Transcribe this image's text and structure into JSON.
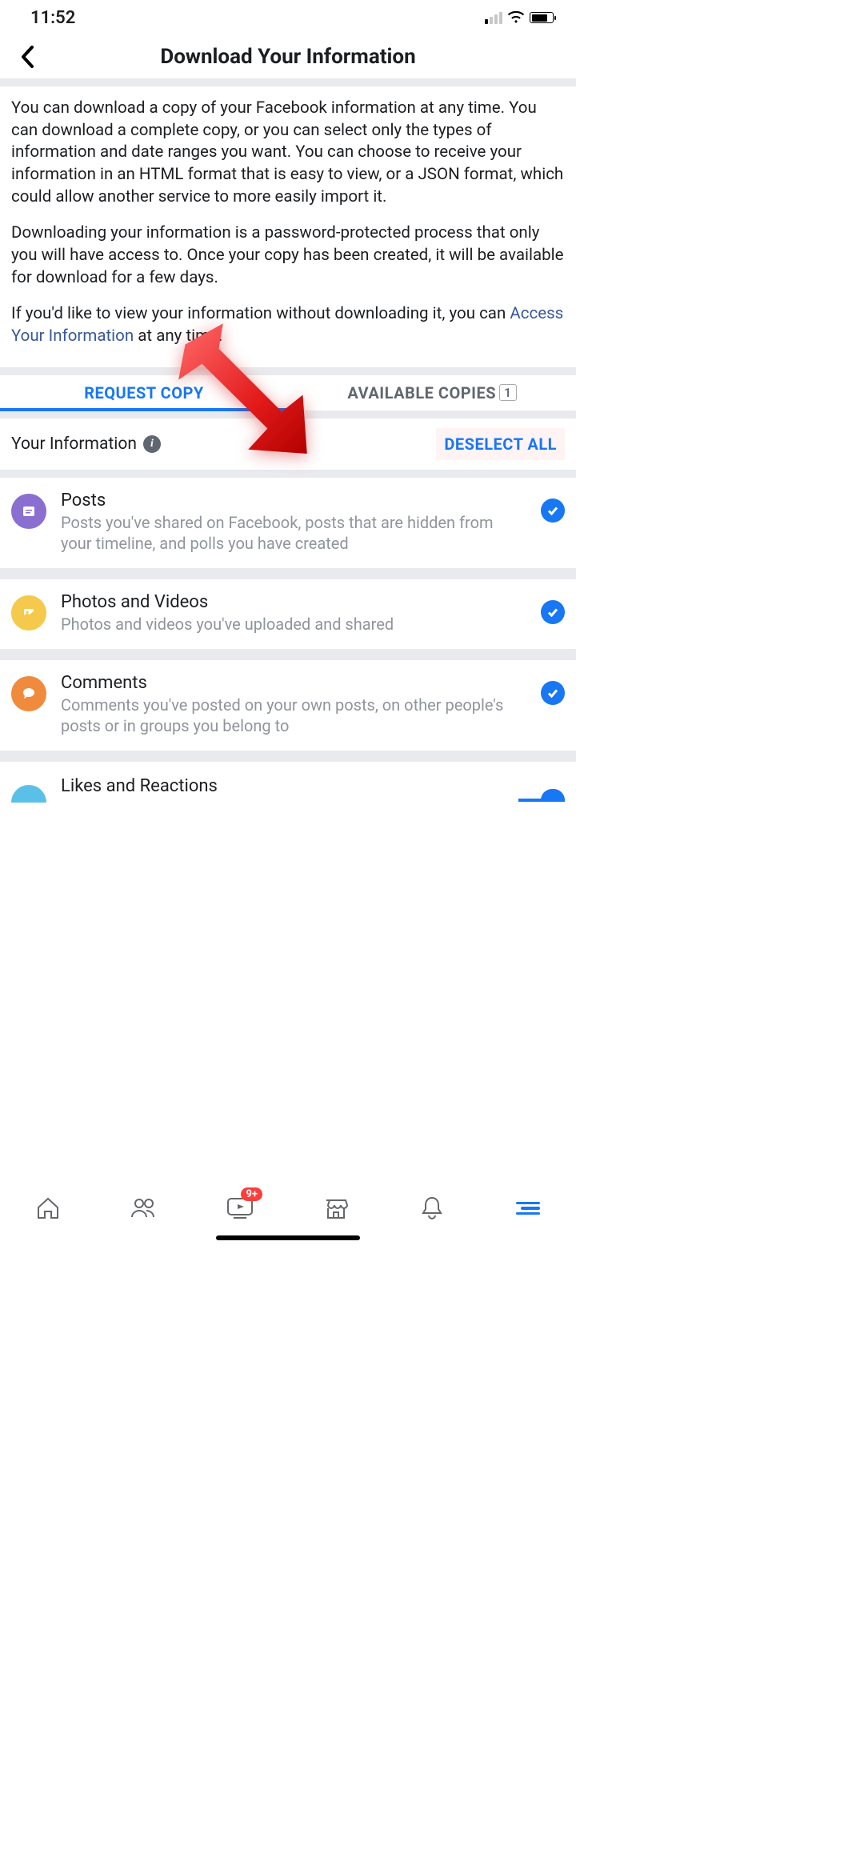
{
  "status": {
    "time": "11:52"
  },
  "header": {
    "title": "Download Your Information"
  },
  "intro": {
    "p1": "You can download a copy of your Facebook information at any time. You can download a complete copy, or you can select only the types of information and date ranges you want. You can choose to receive your information in an HTML format that is easy to view, or a JSON format, which could allow another service to more easily import it.",
    "p2": "Downloading your information is a password-protected process that only you will have access to. Once your copy has been created, it will be available for download for a few days.",
    "p3_pre": "If you'd like to view your information without downloading it, you can ",
    "p3_link": "Access Your Information",
    "p3_post": " at any time."
  },
  "tabs": {
    "request": "REQUEST COPY",
    "available": "AVAILABLE COPIES",
    "count": "1"
  },
  "section": {
    "title": "Your Information",
    "deselect": "DESELECT ALL"
  },
  "items": [
    {
      "title": "Posts",
      "desc": "Posts you've shared on Facebook, posts that are hidden from your timeline, and polls you have created"
    },
    {
      "title": "Photos and Videos",
      "desc": "Photos and videos you've uploaded and shared"
    },
    {
      "title": "Comments",
      "desc": "Comments you've posted on your own posts, on other people's posts or in groups you belong to"
    },
    {
      "title": "Likes and Reactions",
      "desc": ""
    }
  ],
  "tabbar": {
    "badge": "9+"
  }
}
